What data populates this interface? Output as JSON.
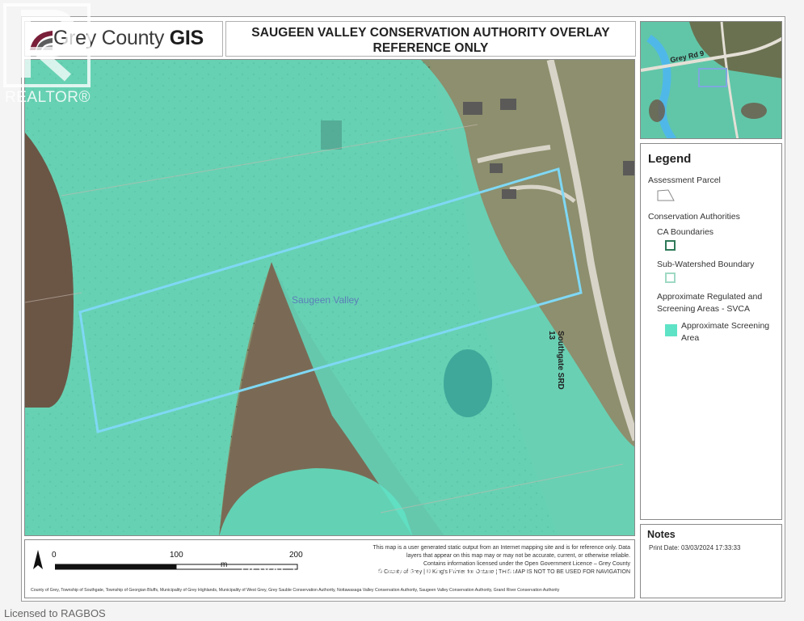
{
  "header": {
    "logo_text_a": "Grey County ",
    "logo_text_b": "GIS",
    "title_line1": "SAUGEEN VALLEY CONSERVATION AUTHORITY OVERLAY",
    "title_line2": "REFERENCE ONLY"
  },
  "map": {
    "area_label": "Saugeen Valley",
    "road_label": "Southgate SRD 13",
    "inset_road_label": "Grey Rd 9",
    "colors": {
      "screening_area": "#5fe3c6",
      "parcel_outline": "#6fd0f0",
      "field": "#7a6e5c"
    }
  },
  "legend": {
    "title": "Legend",
    "assessment_parcel": "Assessment Parcel",
    "conservation_authorities": "Conservation Authorities",
    "ca_boundaries": "CA Boundaries",
    "sub_watershed": "Sub-Watershed Boundary",
    "approx_regulated_line1": "Approximate Regulated and",
    "approx_regulated_line2": "Screening Areas - SVCA",
    "approx_screening_line1": "Approximate Screening",
    "approx_screening_line2": "Area"
  },
  "notes": {
    "title": "Notes",
    "print_date": "Print Date: 03/03/2024 17:33:33"
  },
  "scale": {
    "tick0": "0",
    "tick1": "100",
    "tick2": "200",
    "unit": "m"
  },
  "footer": {
    "disclaimer_1": "This map is a user generated static output from an Internet mapping site and is for reference only. Data",
    "disclaimer_2": "layers that appear on this map may or may not be accurate, current, or otherwise reliable.",
    "disclaimer_3": "Contains information licensed under the Open Government Licence – Grey County",
    "disclaimer_4": "© County of Grey | © King's Printer for Ontario | THIS MAP IS NOT TO BE USED FOR NAVIGATION",
    "credits": "County of Grey, Township of Southgate, Township of Georgian Bluffs, Municipality of Grey Highlands, Municipality of West Grey, Grey Sauble Conservation Authority, Nottawasaga Valley Conservation Authority, Saugeen Valley Conservation Authority, Grand River Conservation Authority"
  },
  "watermarks": {
    "realtor": "REALTOR®",
    "royal_lepage": "ROYAL LEPAGE RCR REALTY, Brokerage",
    "licensed": "Licensed to RAGBOS"
  }
}
